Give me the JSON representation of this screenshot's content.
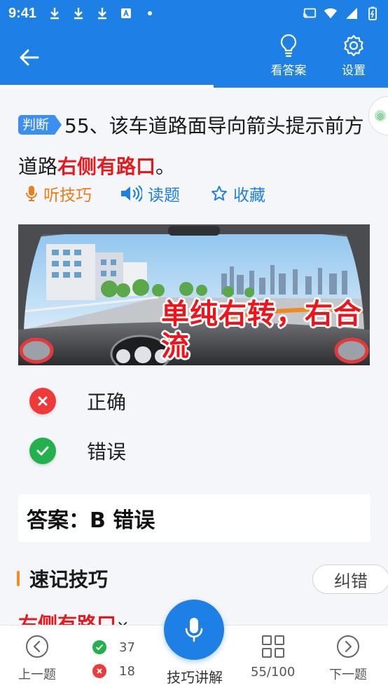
{
  "status_bar": {
    "time": "9:41"
  },
  "app_bar": {
    "show_answer_label": "看答案",
    "settings_label": "设置"
  },
  "question": {
    "tag": "判断",
    "text_prefix": "55、该车道路面导向箭头提示前方道路",
    "text_highlight": "右侧有路口",
    "text_suffix": "。"
  },
  "tools": {
    "listen_label": "听技巧",
    "read_label": "读题",
    "favorite_label": "收藏"
  },
  "scene": {
    "caption": "单纯右转，右合流"
  },
  "options": [
    {
      "label": "正确",
      "state": "wrong"
    },
    {
      "label": "错误",
      "state": "correct"
    }
  ],
  "answer": {
    "text": "答案：B 错误"
  },
  "tips": {
    "heading": "速记技巧",
    "report_label": "纠错",
    "first_line": "右侧有路口",
    "first_line_mark": "×"
  },
  "bottom_bar": {
    "prev_label": "上一题",
    "correct_count": "37",
    "wrong_count": "18",
    "mic_label": "技巧讲解",
    "progress_label": "55/100",
    "next_label": "下一题"
  },
  "colors": {
    "primary": "#1e7fe5",
    "highlight_red": "#e8191c",
    "orange": "#ef7c17",
    "correct_green": "#22b14c",
    "wrong_red": "#f03a3a"
  }
}
